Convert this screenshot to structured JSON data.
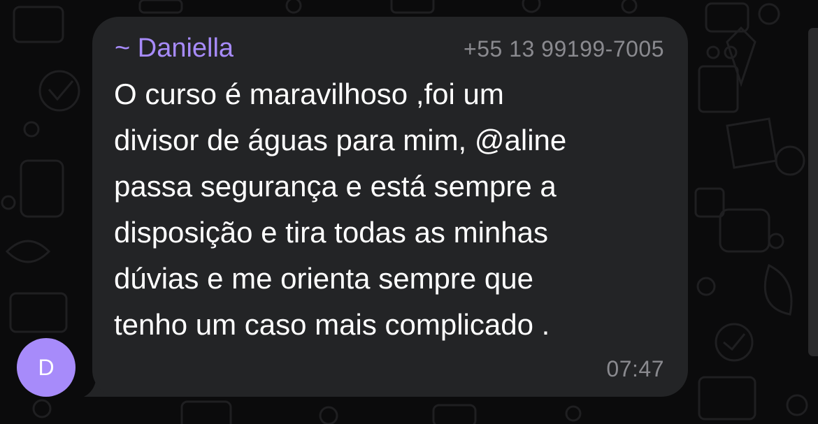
{
  "message": {
    "sender_name": "~ Daniella",
    "sender_phone": "+55 13 99199-7005",
    "text": "O curso é maravilhoso ,foi um\ndivisor de águas para mim, @aline\npassa segurança e está sempre a\ndisposição e tira todas as minhas\ndúvias e me orienta sempre que\ntenho um caso mais complicado .",
    "time": "07:47"
  },
  "avatar": {
    "initial": "D",
    "color": "#a78bfa"
  },
  "colors": {
    "background": "#0b0b0c",
    "bubble": "#232426",
    "sender_name": "#a78bfa",
    "meta_text": "#8a8a8f",
    "message_text": "#ffffff"
  }
}
